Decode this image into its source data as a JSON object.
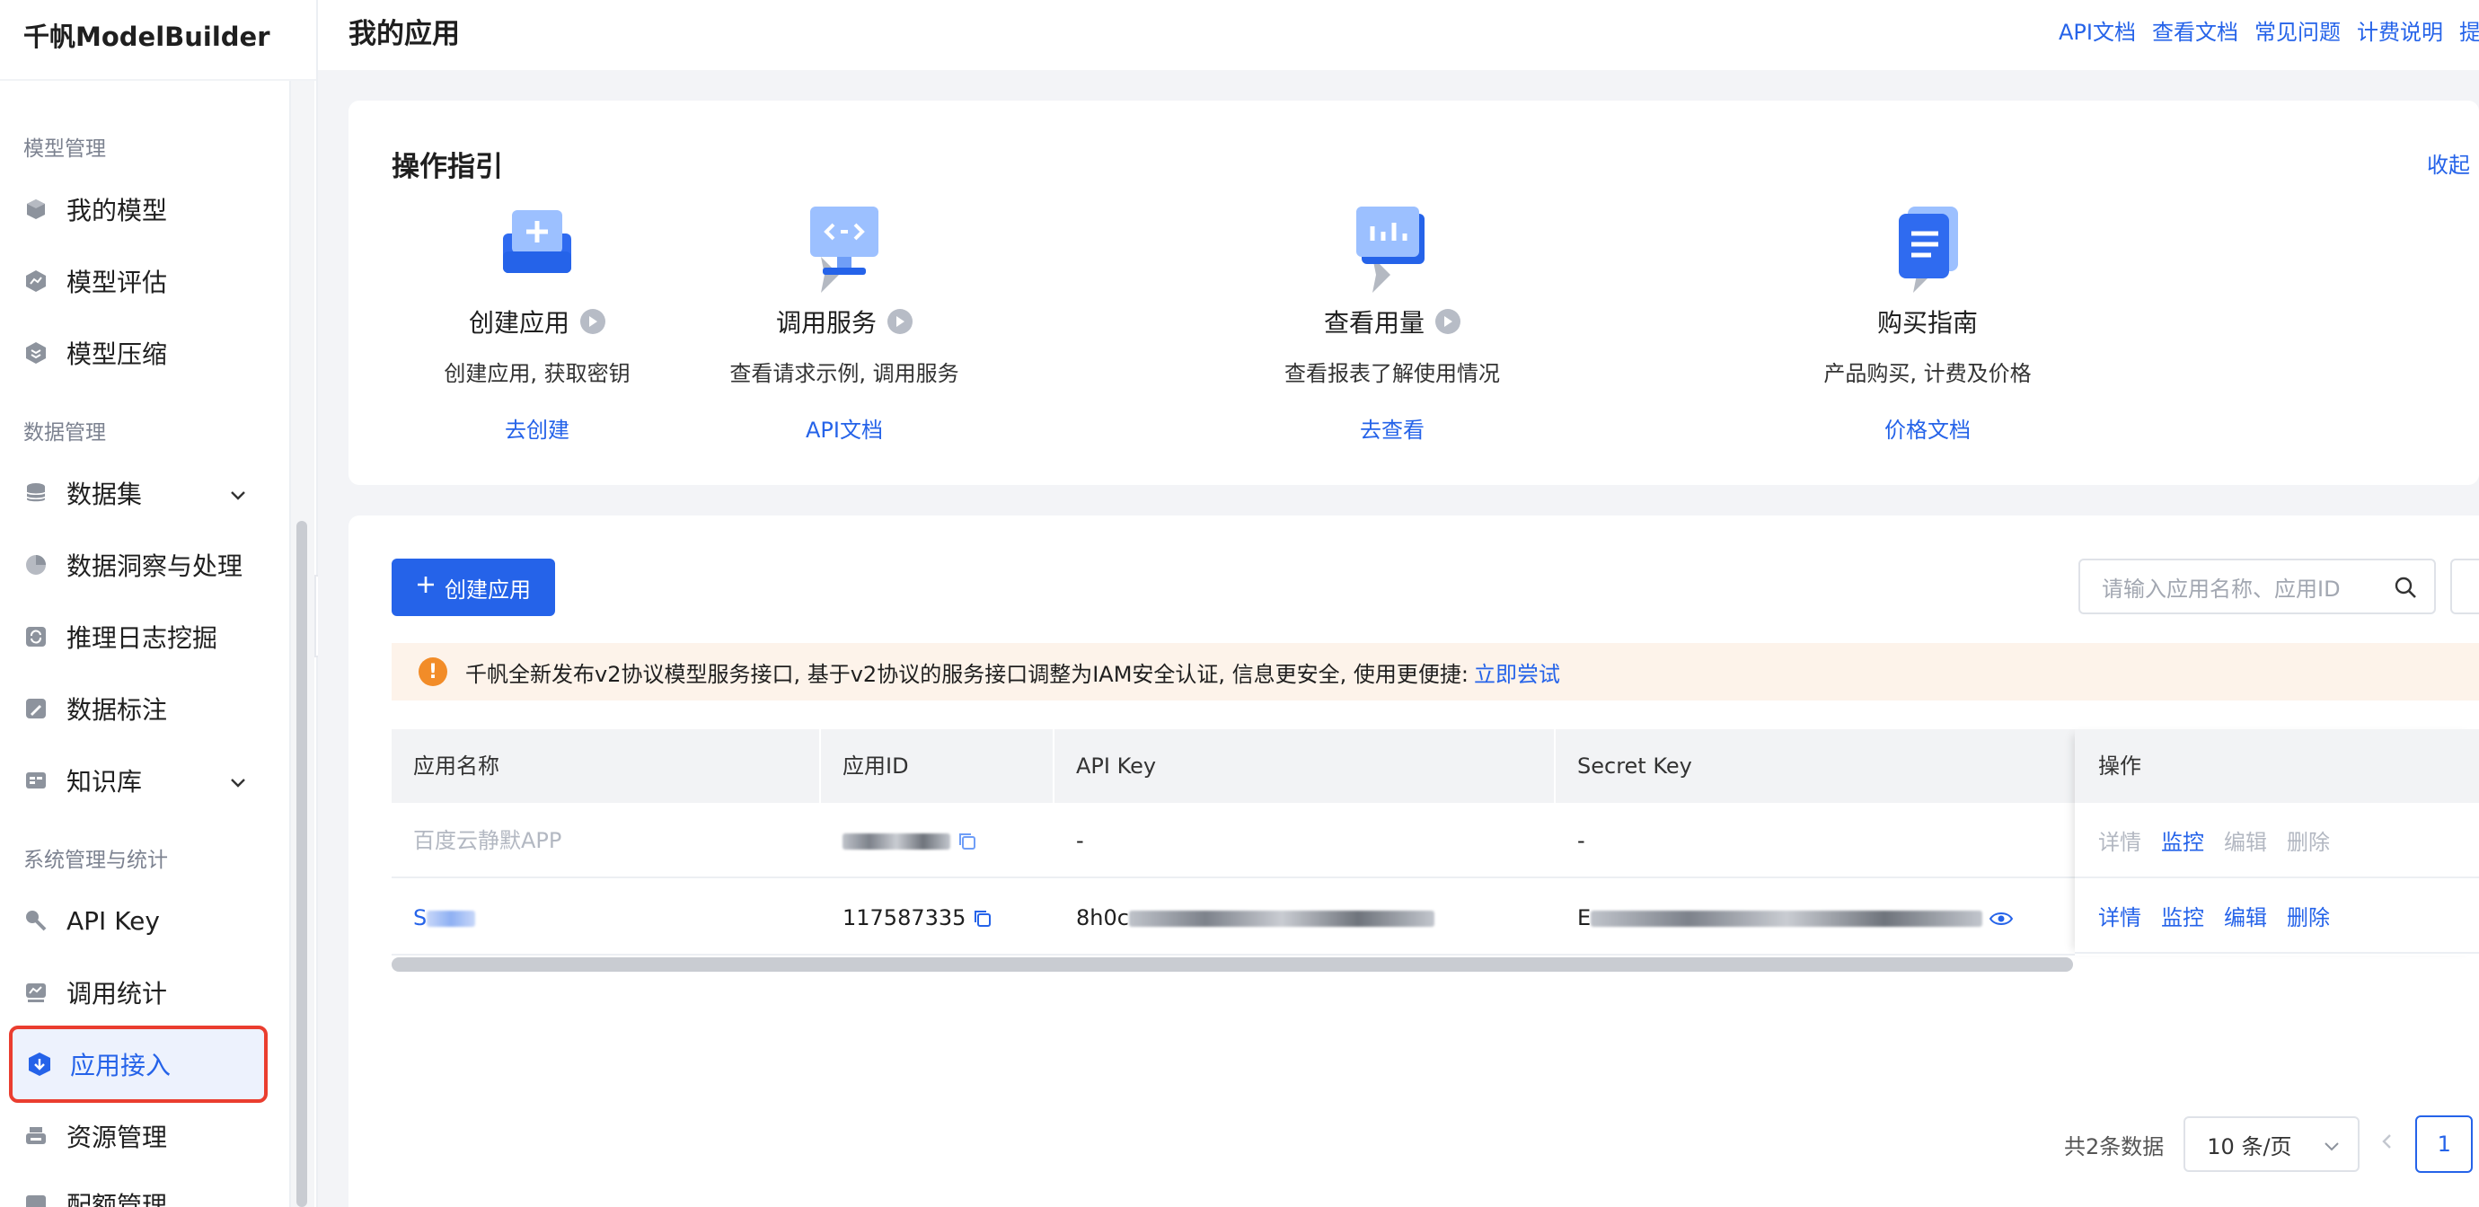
{
  "app": {
    "title": "千帆ModelBuilder"
  },
  "sidebar": {
    "sections": [
      {
        "label": "模型管理"
      },
      {
        "label": "数据管理"
      },
      {
        "label": "系统管理与统计"
      }
    ],
    "items": [
      {
        "label": "我的模型",
        "icon": "cube-icon"
      },
      {
        "label": "模型评估",
        "icon": "chart-hex-icon"
      },
      {
        "label": "模型压缩",
        "icon": "compress-hex-icon"
      },
      {
        "label": "数据集",
        "icon": "database-icon"
      },
      {
        "label": "数据洞察与处理",
        "icon": "pie-icon"
      },
      {
        "label": "推理日志挖掘",
        "icon": "refresh-box-icon"
      },
      {
        "label": "数据标注",
        "icon": "annotate-icon"
      },
      {
        "label": "知识库",
        "icon": "knowledge-icon"
      },
      {
        "label": "API Key",
        "icon": "key-icon"
      },
      {
        "label": "调用统计",
        "icon": "stats-icon"
      },
      {
        "label": "应用接入",
        "icon": "download-shield-icon"
      },
      {
        "label": "资源管理",
        "icon": "printer-icon"
      },
      {
        "label": "配额管理",
        "icon": "quota-icon"
      }
    ],
    "active": "应用接入"
  },
  "header": {
    "title": "我的应用",
    "links": [
      "API文档",
      "查看文档",
      "常见问题",
      "计费说明",
      "提交"
    ]
  },
  "guide": {
    "title": "操作指引",
    "collapse": "收起",
    "steps": [
      {
        "name": "创建应用",
        "desc": "创建应用, 获取密钥",
        "link": "去创建"
      },
      {
        "name": "调用服务",
        "desc": "查看请求示例, 调用服务",
        "link": "API文档"
      },
      {
        "name": "查看用量",
        "desc": "查看报表了解使用情况",
        "link": "去查看"
      },
      {
        "name": "购买指南",
        "desc": "产品购买, 计费及价格",
        "link": "价格文档"
      }
    ]
  },
  "toolbar": {
    "create_label": "创建应用",
    "search_placeholder": "请输入应用名称、应用ID"
  },
  "notice": {
    "text": "千帆全新发布v2协议模型服务接口, 基于v2协议的服务接口调整为IAM安全认证, 信息更安全, 使用更便捷:",
    "link": "立即尝试"
  },
  "table": {
    "columns": [
      "应用名称",
      "应用ID",
      "API Key",
      "Secret Key",
      "操作"
    ],
    "rows": [
      {
        "name": "百度云静默APP",
        "id": "",
        "api_key": "-",
        "secret_key": "-",
        "actions": [
          "详情",
          "监控",
          "编辑",
          "删除"
        ]
      },
      {
        "name": "S",
        "id": "117587335",
        "api_key": "8h0c",
        "secret_key": "E",
        "actions": [
          "详情",
          "监控",
          "编辑",
          "删除"
        ]
      }
    ]
  },
  "pagination": {
    "total": "共2条数据",
    "page_size": "10 条/页",
    "current_page": "1"
  },
  "colors": {
    "accent": "#2563e9",
    "highlight_border": "#ea3d2f",
    "notice_bg": "#fdf3ea",
    "warn": "#f28c28"
  }
}
